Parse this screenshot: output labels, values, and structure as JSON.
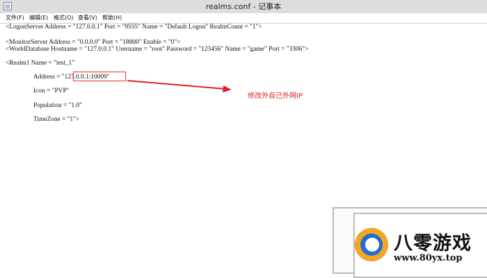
{
  "window": {
    "title": "realms.conf - 记事本"
  },
  "menu": [
    "文件(F)",
    "编辑(E)",
    "格式(O)",
    "查看(V)",
    "帮助(H)"
  ],
  "editor": {
    "lines": [
      "<LogonServer Address = \"127.0.0.1\" Port = \"9555\" Name = \"Default Logon\" RealmCount = \"1\">",
      "<MonitorServer Address = \"0.0.0.0\" Port = \"18800\" Enable = \"0\">",
      "<WorldDatabase Hostname = \"127.0.0.1\" Username = \"root\" Password = \"123456\" Name = \"game\" Port = \"3306\">",
      "<Realm1 Name = \"test_1\"",
      "Address = \"127.0.0.1:10009\"",
      "Icon = \"PVP\"",
      "Population = \"1.0\"",
      "TimeZone = \"1\">"
    ]
  },
  "annotation": {
    "text": "修改外自己外网IP",
    "color": "#e02020"
  },
  "watermark": {
    "brand": "八零游戏",
    "url": "www.80yx.top"
  }
}
